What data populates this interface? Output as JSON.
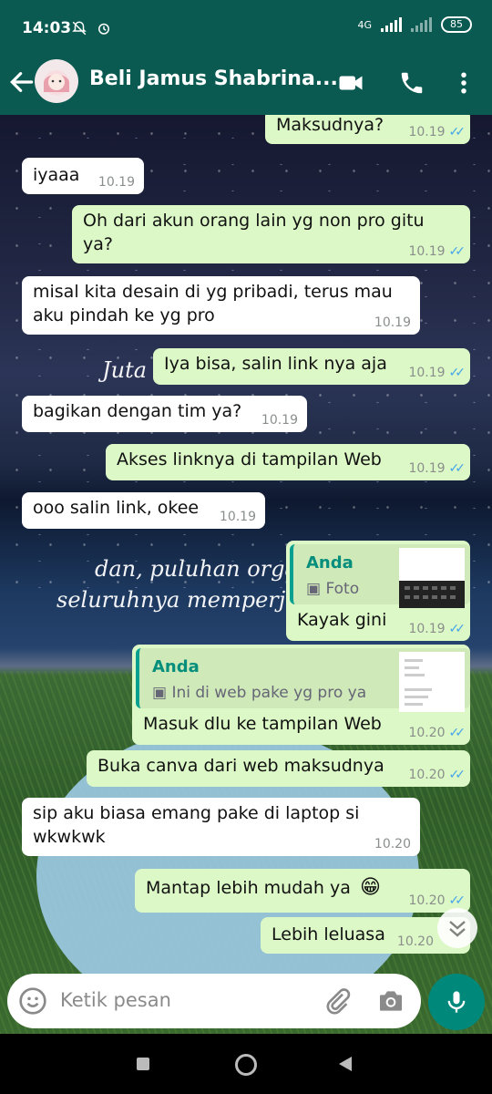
{
  "status_bar": {
    "time": "14:03",
    "network": "4G",
    "battery": "85"
  },
  "header": {
    "contact_name": "Beli Jamus Shabrina...",
    "icons": [
      "back-arrow-icon",
      "video-call-icon",
      "phone-icon",
      "more-vertical-icon"
    ]
  },
  "wallpaper_text": {
    "line1": "Juta",
    "line2": "dan, puluhan orga",
    "line3": "seluruhnya memperj"
  },
  "messages": [
    {
      "dir": "out",
      "text": "Maksudnya?",
      "time": "10.19",
      "read": true
    },
    {
      "dir": "in",
      "text": "iyaaa",
      "time": "10.19"
    },
    {
      "dir": "out",
      "text": "Oh dari akun orang lain yg non pro gitu ya?",
      "time": "10.19",
      "read": true
    },
    {
      "dir": "in",
      "text": "misal kita desain di yg pribadi, terus mau aku pindah ke yg pro",
      "time": "10.19"
    },
    {
      "dir": "out",
      "text": "Iya bisa, salin link nya aja",
      "time": "10.19",
      "read": true
    },
    {
      "dir": "in",
      "text": "bagikan dengan tim ya?",
      "time": "10.19"
    },
    {
      "dir": "out",
      "text": "Akses linknya di tampilan Web",
      "time": "10.19",
      "read": true
    },
    {
      "dir": "in",
      "text": "ooo salin link, okee",
      "time": "10.19"
    },
    {
      "dir": "out",
      "quote_author": "Anda",
      "quote_text": "Foto",
      "text": "Kayak gini",
      "time": "10.19",
      "read": true
    },
    {
      "dir": "out",
      "quote_author": "Anda",
      "quote_text": "Ini di web pake yg pro ya",
      "text": "Masuk dlu ke tampilan Web",
      "time": "10.20",
      "read": true
    },
    {
      "dir": "out",
      "text": "Buka canva dari web maksudnya",
      "time": "10.20",
      "read": true
    },
    {
      "dir": "in",
      "text": "sip aku biasa emang pake di laptop si wkwkwk",
      "time": "10.20"
    },
    {
      "dir": "out",
      "text": "Mantap lebih mudah ya",
      "emoji": "😁",
      "time": "10.20",
      "read": true
    },
    {
      "dir": "out",
      "text": "Lebih leluasa",
      "time": "10.20",
      "read": true
    }
  ],
  "composer": {
    "placeholder": "Ketik pesan",
    "icons": [
      "emoji-icon",
      "attach-icon",
      "camera-icon",
      "mic-icon"
    ]
  },
  "colors": {
    "header": "#0a5a52",
    "outgoing_bubble": "#dcf8c6",
    "incoming_bubble": "#ffffff",
    "read_ticks": "#43a5e8",
    "mic_button": "#00897b"
  }
}
